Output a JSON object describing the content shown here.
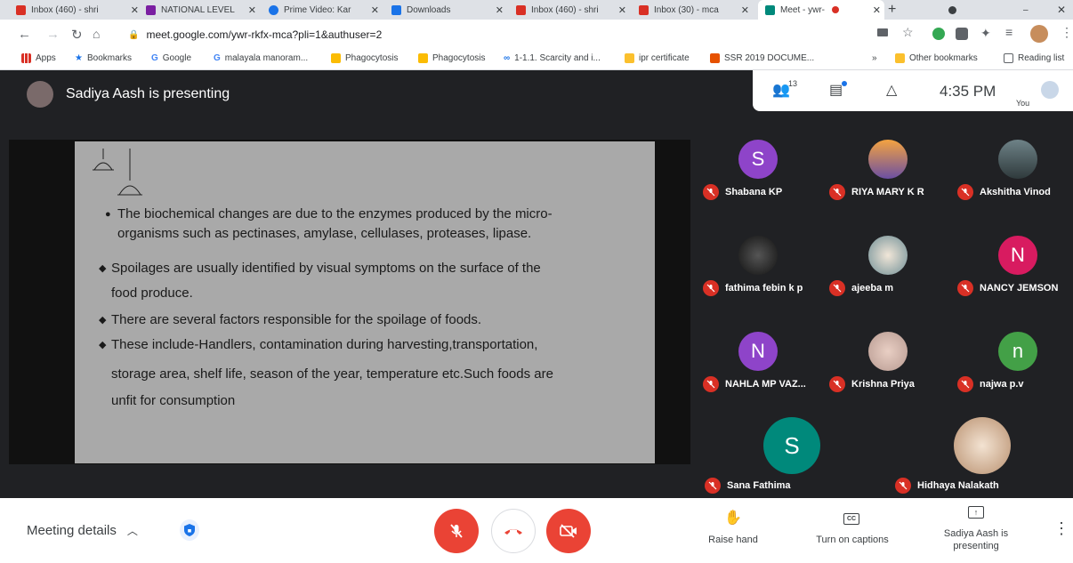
{
  "browser": {
    "tabs": [
      {
        "label": "Inbox (460) - shri",
        "color": "#d93025"
      },
      {
        "label": "NATIONAL LEVEL",
        "color": "#7b1fa2"
      },
      {
        "label": "Prime Video: Kar",
        "color": "#1a73e8"
      },
      {
        "label": "Downloads",
        "color": "#1a73e8"
      },
      {
        "label": "Inbox (460) - shri",
        "color": "#d93025"
      },
      {
        "label": "Inbox (30) - mca",
        "color": "#d93025"
      },
      {
        "label": "Meet - ywr-",
        "color": "#00897b"
      }
    ],
    "url": "meet.google.com/ywr-rkfx-mca?pli=1&authuser=2",
    "bookmarks": [
      {
        "label": "Apps",
        "icon": "apps-grid-icon",
        "color": "#1a73e8"
      },
      {
        "label": "Bookmarks",
        "icon": "star-icon",
        "color": "#1a73e8"
      },
      {
        "label": "Google",
        "icon": "google-g-icon",
        "color": "#4285f4"
      },
      {
        "label": "malayala manoram...",
        "icon": "google-g-icon",
        "color": "#4285f4"
      },
      {
        "label": "Phagocytosis",
        "icon": "doc-icon",
        "color": "#fbbc04"
      },
      {
        "label": "Phagocytosis",
        "icon": "doc-icon",
        "color": "#fbbc04"
      },
      {
        "label": "1-1.1. Scarcity and i...",
        "icon": "link-icon",
        "color": "#1a73e8"
      },
      {
        "label": "ipr certificate",
        "icon": "folder-icon",
        "color": "#fbc02d"
      },
      {
        "label": "SSR 2019 DOCUME...",
        "icon": "leaf-icon",
        "color": "#e65100"
      }
    ],
    "other_bookmarks": "Other bookmarks",
    "reading_list": "Reading list",
    "overflow": "»"
  },
  "meet": {
    "presenter_text": "Sadiya Aash is presenting",
    "participant_count": "13",
    "time": "4:35 PM",
    "you_label": "You",
    "slide": {
      "bullets": [
        "The biochemical changes are due to the enzymes produced by the micro-",
        "organisms such as pectinases, amylase, cellulases, proteases, lipase.",
        "Spoilages are usually identified by visual symptoms on the surface of the",
        "food produce.",
        "There are several factors responsible for the spoilage of foods.",
        "These include-Handlers, contamination during harvesting,transportation,",
        "storage area, shelf life, season of the year, temperature etc.Such foods are",
        "unfit for consumption"
      ]
    },
    "participants": [
      {
        "name": "Shabana KP",
        "initial": "S",
        "avatar_color": "#8e44c9",
        "photo": false
      },
      {
        "name": "RIYA MARY K R",
        "initial": "",
        "avatar_color": "#e08a2e",
        "photo": true
      },
      {
        "name": "Akshitha Vinod",
        "initial": "",
        "avatar_color": "#4b5b5e",
        "photo": true
      },
      {
        "name": "fathima febin k p",
        "initial": "",
        "avatar_color": "#2b2b2b",
        "photo": true
      },
      {
        "name": "ajeeba m",
        "initial": "",
        "avatar_color": "#6f8f96",
        "photo": true
      },
      {
        "name": "NANCY JEMSON",
        "initial": "N",
        "avatar_color": "#d81b60",
        "photo": false
      },
      {
        "name": "NAHLA MP VAZ...",
        "initial": "N",
        "avatar_color": "#8e44c9",
        "photo": false
      },
      {
        "name": "Krishna Priya",
        "initial": "",
        "avatar_color": "#c9a9a0",
        "photo": true
      },
      {
        "name": "najwa p.v",
        "initial": "n",
        "avatar_color": "#43a047",
        "photo": false
      },
      {
        "name": "Sana Fathima",
        "initial": "S",
        "avatar_color": "#00897b",
        "photo": false
      },
      {
        "name": "Hidhaya Nalakath",
        "initial": "",
        "avatar_color": "#d8c0a8",
        "photo": true
      }
    ],
    "bottom": {
      "meeting_details": "Meeting details",
      "raise_hand": "Raise hand",
      "captions": "Turn on captions",
      "presenting": "Sadiya Aash is presenting",
      "mute_color": "#ea4335",
      "leave_color": "#ea4335"
    }
  }
}
